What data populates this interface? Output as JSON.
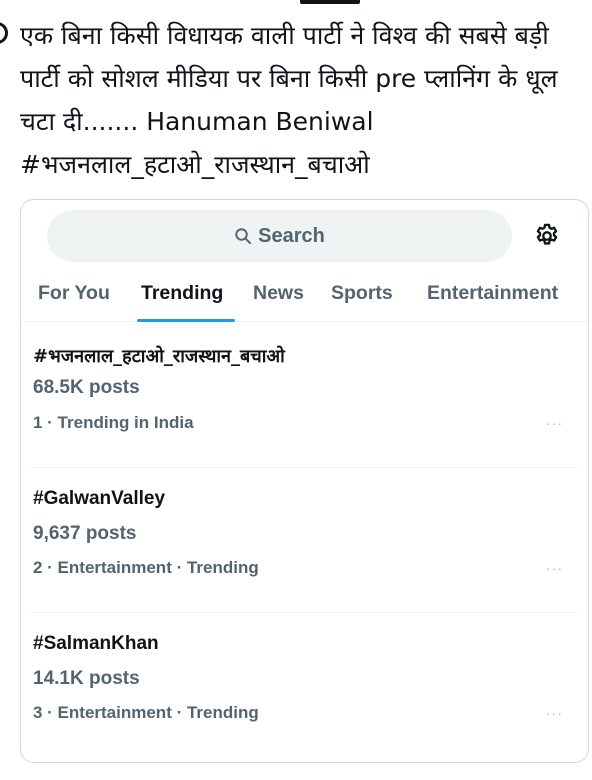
{
  "post": {
    "text": "एक बिना किसी विधायक वाली पार्टी ने विश्व की सबसे बड़ी पार्टी को सोशल मीडिया पर बिना किसी pre प्लानिंग के धूल चटा दी....... Hanuman Beniwal #भजनलाल_हटाओ_राजस्थान_बचाओ"
  },
  "search": {
    "placeholder": "Search",
    "icon": "search-icon"
  },
  "settings": {
    "icon": "gear-icon"
  },
  "tabs": [
    {
      "label": "For You",
      "active": false
    },
    {
      "label": "Trending",
      "active": true
    },
    {
      "label": "News",
      "active": false
    },
    {
      "label": "Sports",
      "active": false
    },
    {
      "label": "Entertainment",
      "active": false
    }
  ],
  "trends": [
    {
      "name": "#भजनलाल_हटाओ_राजस्थान_बचाओ",
      "posts": "68.5K posts",
      "meta": "1 · Trending in India",
      "more": "···"
    },
    {
      "name": "#GalwanValley",
      "posts": "9,637 posts",
      "meta": "2 · Entertainment · Trending",
      "more": "···"
    },
    {
      "name": "#SalmanKhan",
      "posts": "14.1K posts",
      "meta": "3 · Entertainment · Trending",
      "more": "···"
    }
  ],
  "colors": {
    "accent": "#1d9bf0",
    "text": "#0f1419",
    "muted": "#536471",
    "search_bg": "#eff3f4",
    "border": "#cfd9de"
  }
}
